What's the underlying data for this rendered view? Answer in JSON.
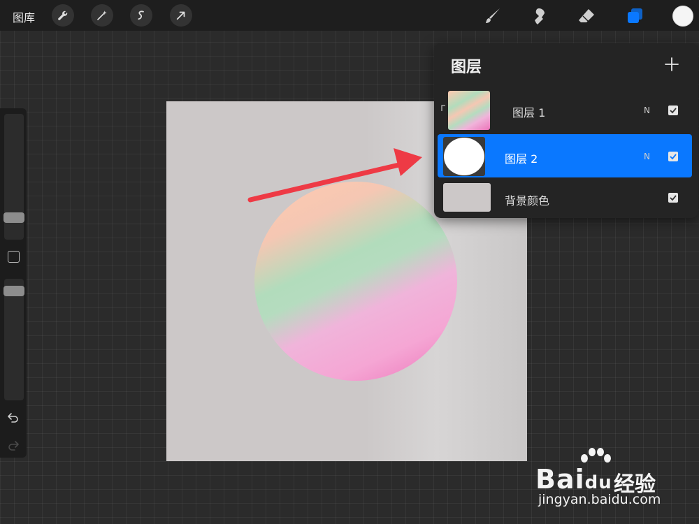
{
  "topbar": {
    "gallery_label": "图库",
    "tools_left": [
      "wrench-icon",
      "magic-wand-icon",
      "selection-icon",
      "transform-arrow-icon"
    ],
    "tools_right": [
      "brush-icon",
      "smudge-icon",
      "eraser-icon",
      "layers-icon"
    ],
    "active_color": "#f5f5f5",
    "accent": "#0a78ff"
  },
  "sidebar": {
    "brush_size_level": 0.6,
    "opacity_level": 0.0
  },
  "layers_panel": {
    "title": "图层",
    "layers": [
      {
        "name": "图层 1",
        "blend": "N",
        "visible": true,
        "selected": false,
        "clipped": true
      },
      {
        "name": "图层 2",
        "blend": "N",
        "visible": true,
        "selected": true,
        "clipped": false
      },
      {
        "name": "背景颜色",
        "blend": "",
        "visible": true,
        "selected": false,
        "clipped": false
      }
    ]
  },
  "watermark": {
    "brand": "Bai",
    "brand_du": "du",
    "product": "经验",
    "url": "jingyan.baidu.com"
  }
}
